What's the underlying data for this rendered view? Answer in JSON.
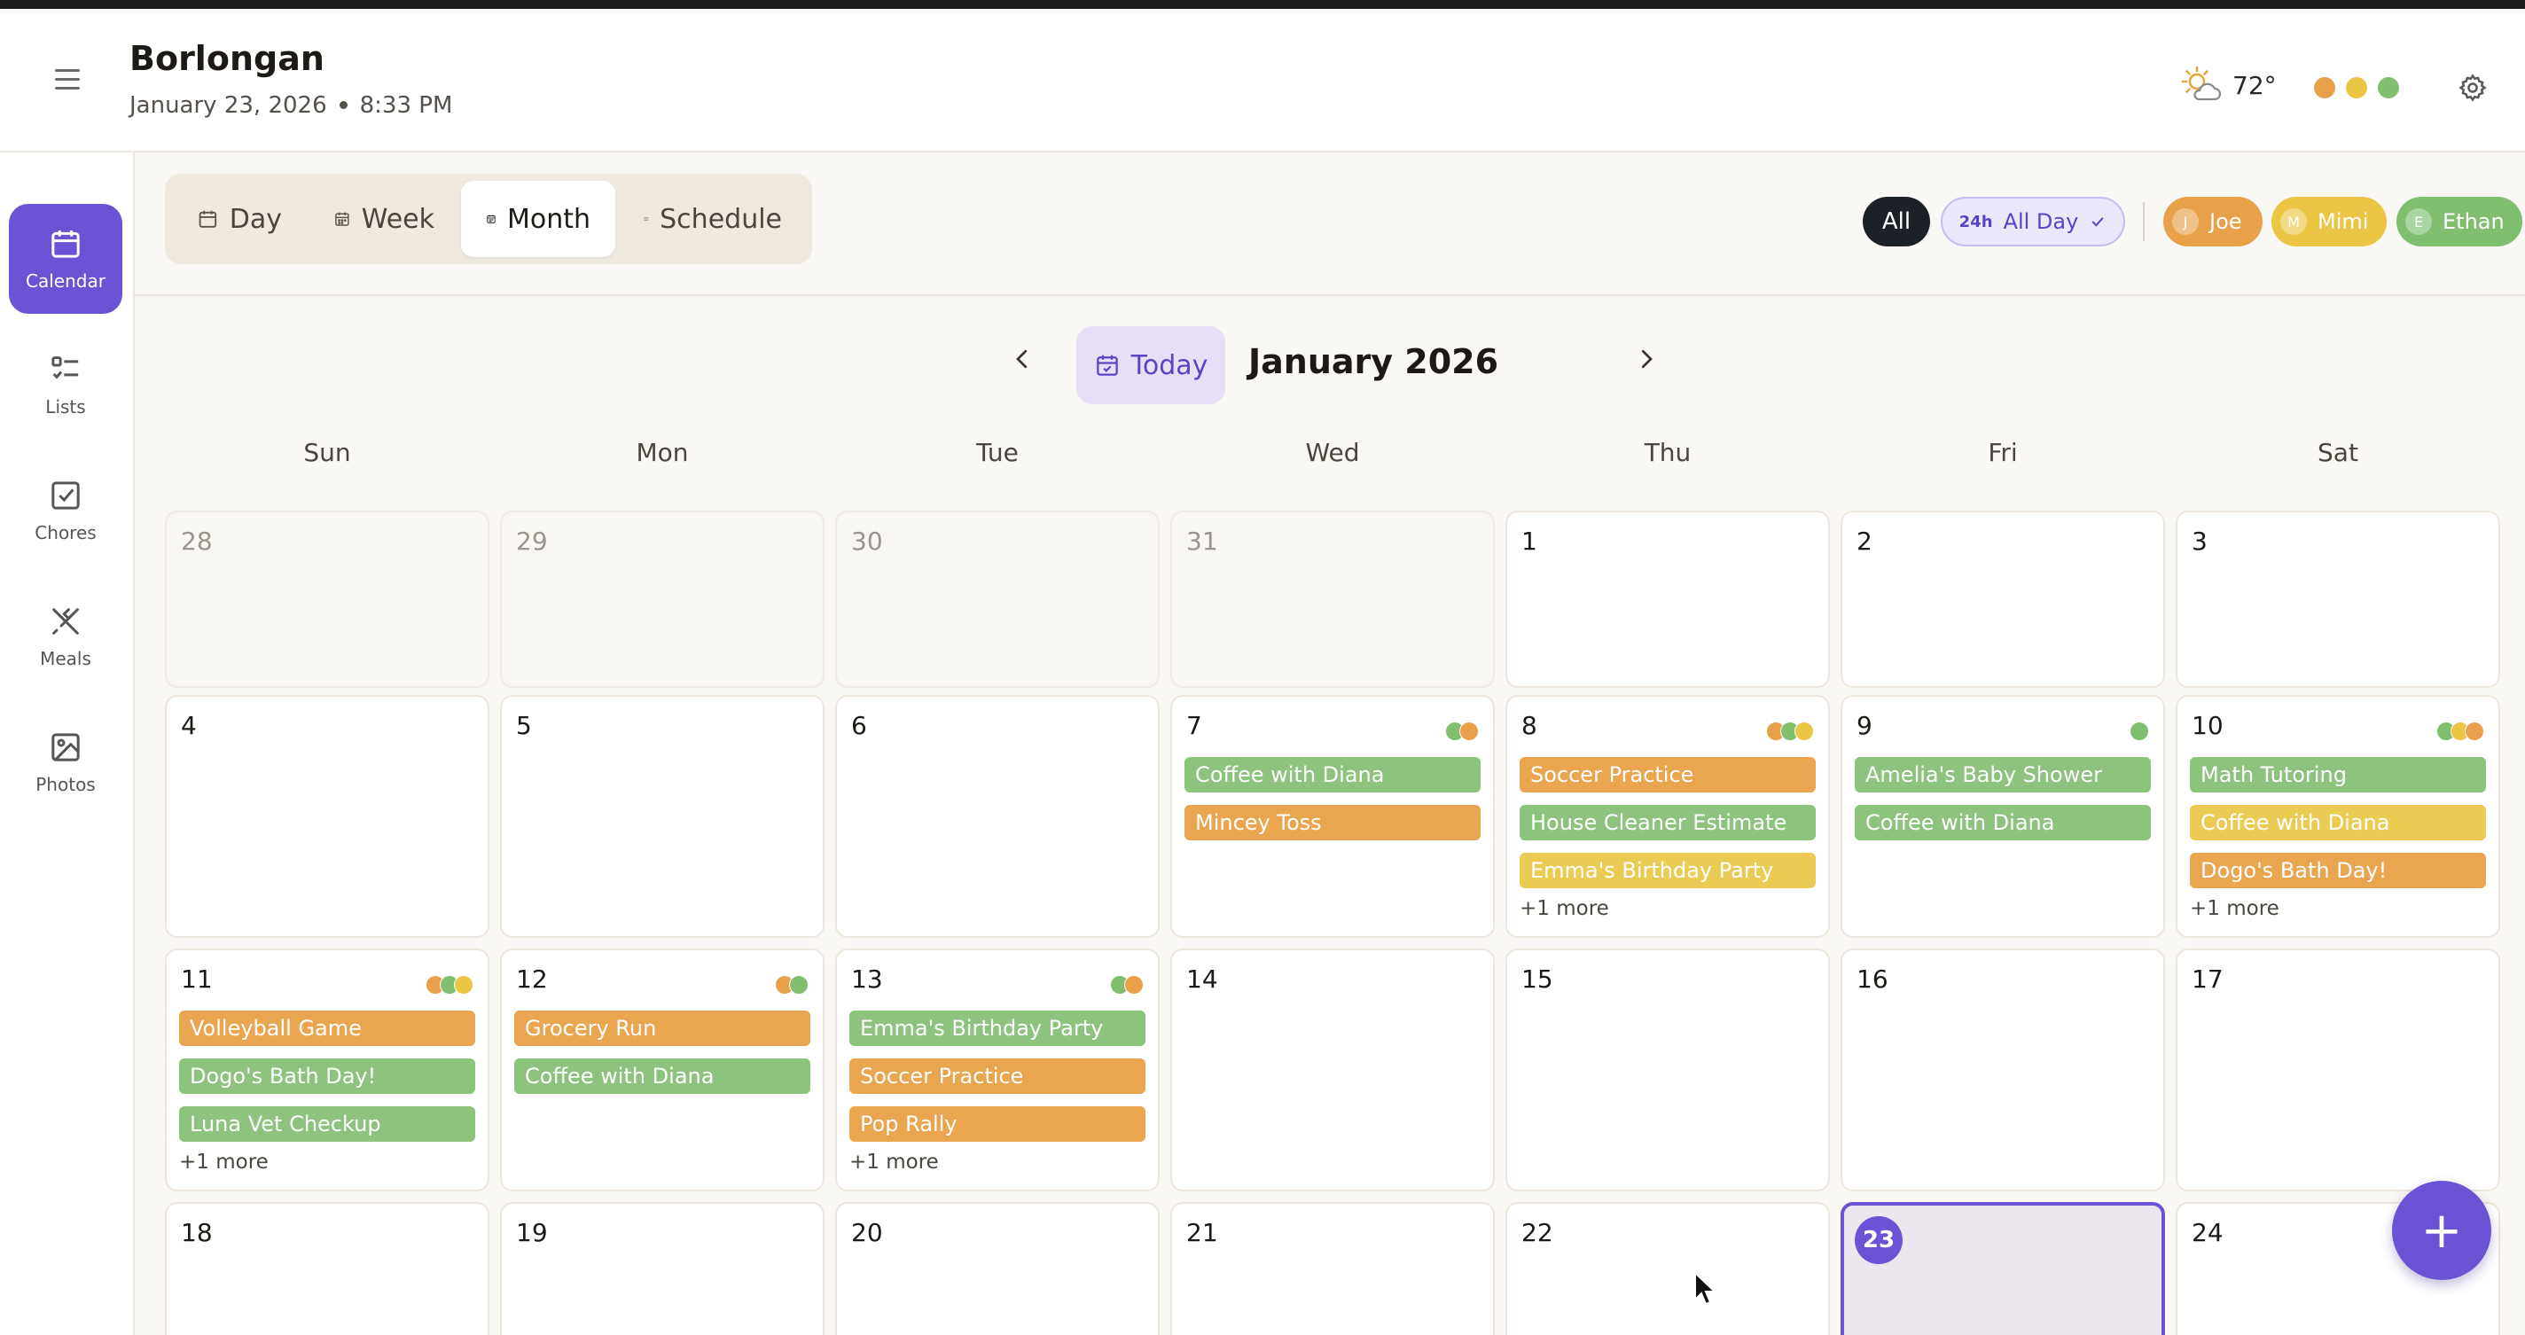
{
  "header": {
    "title": "Borlongan",
    "date": "January 23, 2026",
    "time": "8:33 PM",
    "weather": {
      "temp": "72°",
      "icon": "partly-cloudy-icon"
    },
    "member_dots": [
      "#e8a04a",
      "#ecc544",
      "#7fbf6e"
    ]
  },
  "sidebar": {
    "items": [
      {
        "label": "Calendar",
        "icon": "calendar-icon",
        "active": true
      },
      {
        "label": "Lists",
        "icon": "list-icon"
      },
      {
        "label": "Chores",
        "icon": "checkbox-icon"
      },
      {
        "label": "Meals",
        "icon": "utensils-icon"
      },
      {
        "label": "Photos",
        "icon": "image-icon"
      }
    ]
  },
  "toolbar": {
    "views": [
      {
        "label": "Day",
        "icon": "calendar-day-icon"
      },
      {
        "label": "Week",
        "icon": "calendar-week-icon"
      },
      {
        "label": "Month",
        "icon": "calendar-month-icon",
        "active": true
      },
      {
        "label": "Schedule",
        "icon": "schedule-list-icon"
      }
    ],
    "filter_all": "All",
    "all_day_tag": "24h",
    "all_day_label": "All Day",
    "people": [
      {
        "initial": "J",
        "name": "Joe",
        "color": "#e8a04a"
      },
      {
        "initial": "M",
        "name": "Mimi",
        "color": "#ecc544"
      },
      {
        "initial": "E",
        "name": "Ethan",
        "color": "#7fbf6e"
      }
    ]
  },
  "calendar": {
    "today_label": "Today",
    "month_title": "January 2026",
    "weekdays": [
      "Sun",
      "Mon",
      "Tue",
      "Wed",
      "Thu",
      "Fri",
      "Sat"
    ],
    "weeks": [
      [
        {
          "day": "28",
          "muted": true
        },
        {
          "day": "29",
          "muted": true
        },
        {
          "day": "30",
          "muted": true
        },
        {
          "day": "31",
          "muted": true
        },
        {
          "day": "1"
        },
        {
          "day": "2"
        },
        {
          "day": "3"
        }
      ],
      [
        {
          "day": "4"
        },
        {
          "day": "5"
        },
        {
          "day": "6"
        },
        {
          "day": "7",
          "dots": [
            "#7fbf6e",
            "#e8a04a"
          ],
          "events": [
            {
              "title": "Coffee with Diana",
              "color": "#8cc47d"
            },
            {
              "title": "Mincey Toss",
              "color": "#e9a550"
            }
          ]
        },
        {
          "day": "8",
          "dots": [
            "#e8a04a",
            "#7fbf6e",
            "#ecc544"
          ],
          "events": [
            {
              "title": "Soccer Practice",
              "color": "#e9a550"
            },
            {
              "title": "House Cleaner Estimate",
              "color": "#8cc47d"
            },
            {
              "title": "Emma's Birthday Party",
              "color": "#eccb55"
            }
          ],
          "more": "+1 more"
        },
        {
          "day": "9",
          "dots": [
            "#7fbf6e"
          ],
          "events": [
            {
              "title": "Amelia's Baby Shower",
              "color": "#8cc47d"
            },
            {
              "title": "Coffee with Diana",
              "color": "#8cc47d"
            }
          ]
        },
        {
          "day": "10",
          "dots": [
            "#7fbf6e",
            "#ecc544",
            "#e8a04a"
          ],
          "events": [
            {
              "title": "Math Tutoring",
              "color": "#8cc47d"
            },
            {
              "title": "Coffee with Diana",
              "color": "#eccb55"
            },
            {
              "title": "Dogo's Bath Day!",
              "color": "#e9a550"
            }
          ],
          "more": "+1 more"
        }
      ],
      [
        {
          "day": "11",
          "dots": [
            "#e8a04a",
            "#7fbf6e",
            "#ecc544"
          ],
          "events": [
            {
              "title": "Volleyball Game",
              "color": "#e9a550"
            },
            {
              "title": "Dogo's Bath Day!",
              "color": "#8cc47d"
            },
            {
              "title": "Luna Vet Checkup",
              "color": "#8cc47d"
            }
          ],
          "more": "+1 more"
        },
        {
          "day": "12",
          "dots": [
            "#e8a04a",
            "#7fbf6e"
          ],
          "events": [
            {
              "title": "Grocery Run",
              "color": "#e9a550"
            },
            {
              "title": "Coffee with Diana",
              "color": "#8cc47d"
            }
          ]
        },
        {
          "day": "13",
          "dots": [
            "#7fbf6e",
            "#e8a04a"
          ],
          "events": [
            {
              "title": "Emma's Birthday Party",
              "color": "#8cc47d"
            },
            {
              "title": "Soccer Practice",
              "color": "#e9a550"
            },
            {
              "title": "Pop Rally",
              "color": "#e9a550"
            }
          ],
          "more": "+1 more"
        },
        {
          "day": "14"
        },
        {
          "day": "15"
        },
        {
          "day": "16"
        },
        {
          "day": "17"
        }
      ],
      [
        {
          "day": "18"
        },
        {
          "day": "19"
        },
        {
          "day": "20"
        },
        {
          "day": "21"
        },
        {
          "day": "22"
        },
        {
          "day": "23",
          "today": true
        },
        {
          "day": "24"
        }
      ]
    ]
  },
  "fab": {
    "label": "+",
    "icon": "plus-icon"
  }
}
